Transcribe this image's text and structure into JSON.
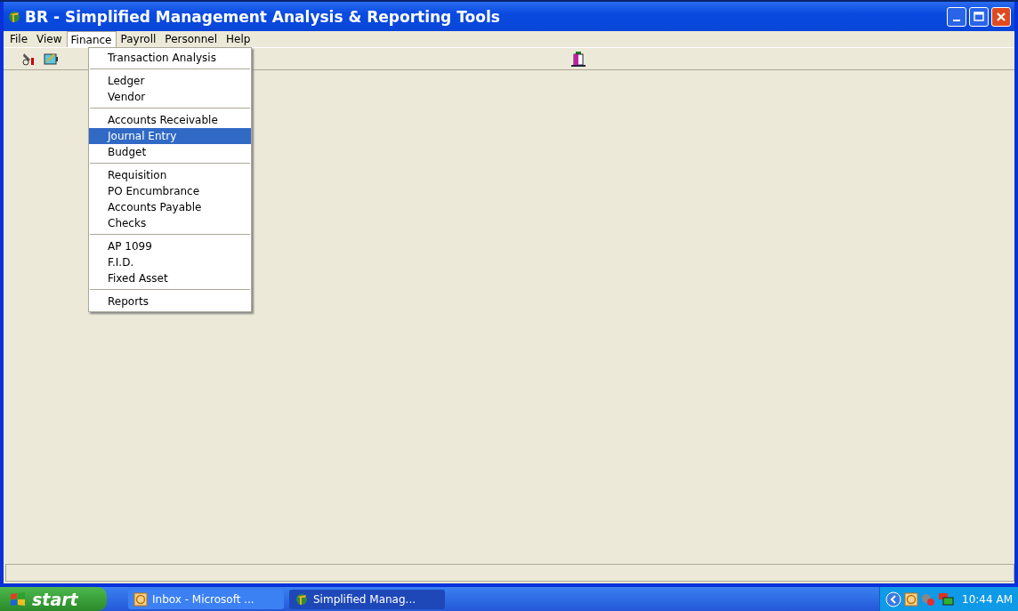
{
  "window": {
    "title": "BR - Simplified Management Analysis & Reporting Tools"
  },
  "menu_bar": [
    {
      "label": "File",
      "selected": false
    },
    {
      "label": "View",
      "selected": false
    },
    {
      "label": "Finance",
      "selected": true
    },
    {
      "label": "Payroll",
      "selected": false
    },
    {
      "label": "Personnel",
      "selected": false
    },
    {
      "label": "Help",
      "selected": false
    }
  ],
  "finance_menu": [
    [
      {
        "label": "Transaction Analysis",
        "selected": false
      }
    ],
    [
      {
        "label": "Ledger",
        "selected": false
      },
      {
        "label": "Vendor",
        "selected": false
      }
    ],
    [
      {
        "label": "Accounts Receivable",
        "selected": false
      },
      {
        "label": "Journal Entry",
        "selected": true
      },
      {
        "label": "Budget",
        "selected": false
      }
    ],
    [
      {
        "label": "Requisition",
        "selected": false
      },
      {
        "label": "PO Encumbrance",
        "selected": false
      },
      {
        "label": "Accounts Payable",
        "selected": false
      },
      {
        "label": "Checks",
        "selected": false
      }
    ],
    [
      {
        "label": "AP 1099",
        "selected": false
      },
      {
        "label": "F.I.D.",
        "selected": false
      },
      {
        "label": "Fixed Asset",
        "selected": false
      }
    ],
    [
      {
        "label": "Reports",
        "selected": false
      }
    ]
  ],
  "taskbar": {
    "start": "start",
    "tasks": [
      {
        "label": "Inbox - Microsoft ...",
        "selected": false,
        "kind": "mail"
      },
      {
        "label": "Simplified Manag...",
        "selected": true,
        "kind": "app"
      }
    ],
    "clock": "10:44 AM"
  }
}
